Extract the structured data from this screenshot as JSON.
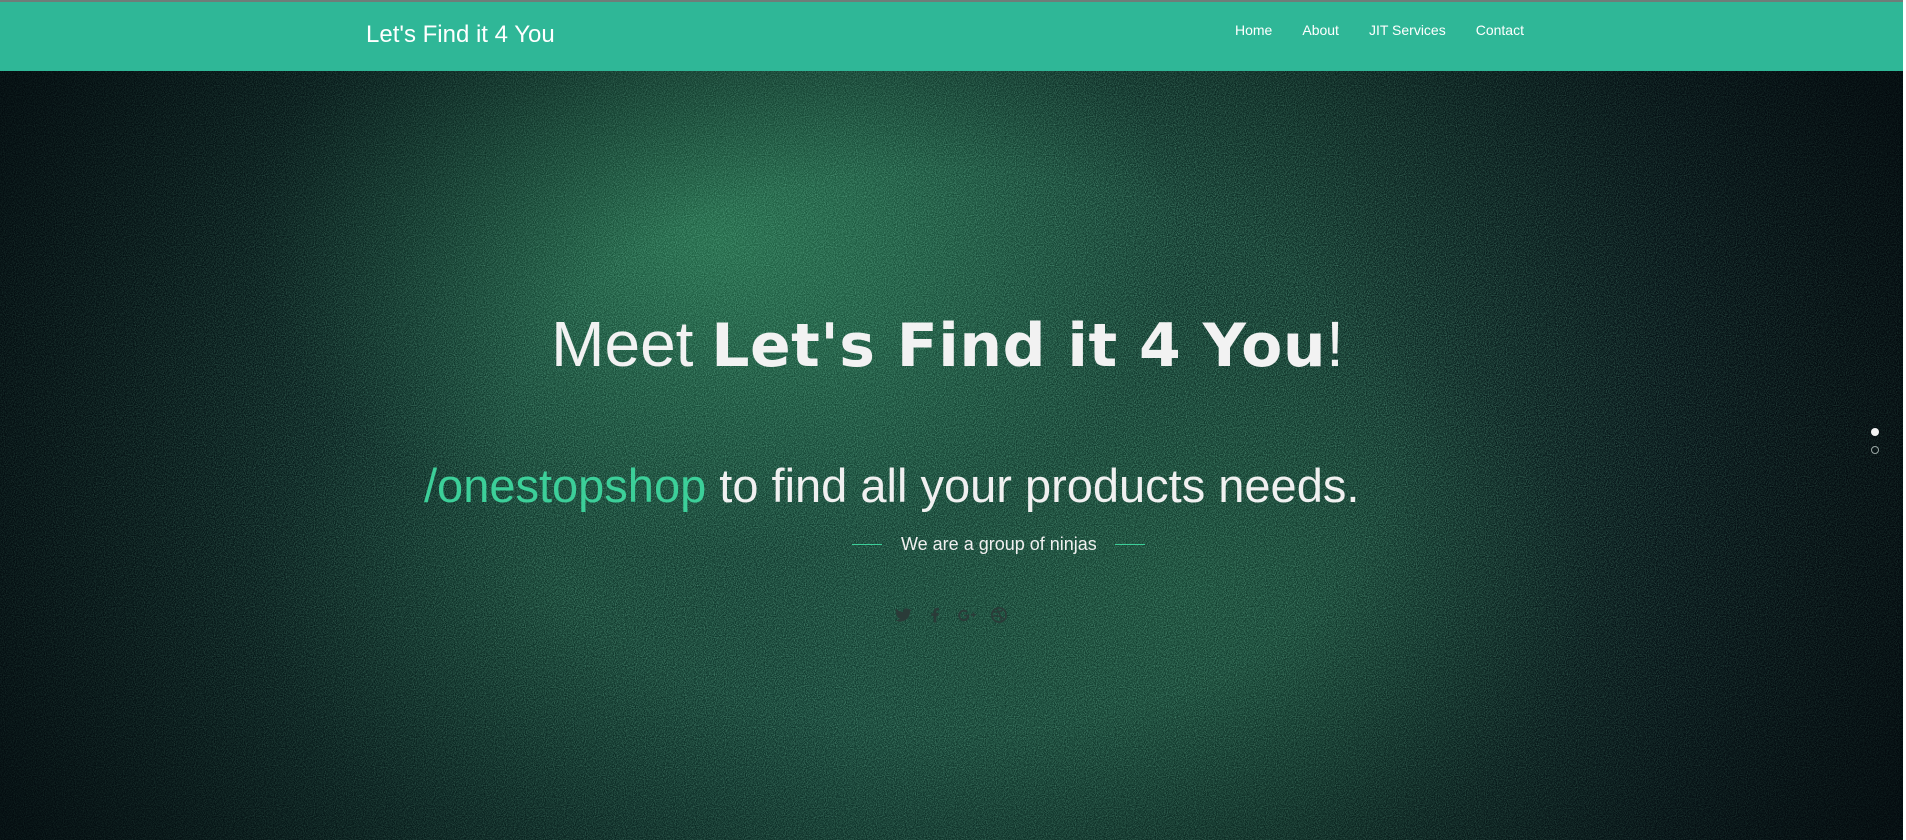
{
  "navbar": {
    "brand": "Let's Find it 4 You",
    "links": [
      {
        "label": "Home"
      },
      {
        "label": "About"
      },
      {
        "label": "JIT Services"
      },
      {
        "label": "Contact"
      }
    ],
    "background_color": "#2fb797"
  },
  "hero": {
    "title_prefix": "Meet ",
    "title_bold": "Let's Find it 4 You",
    "title_suffix": "!",
    "tagline_accent": "/onestopshop",
    "tagline_rest": " to find all your products needs.",
    "subline": "We are a group of ninjas",
    "accent_color": "#3ccf99",
    "social_icons": [
      "twitter-icon",
      "facebook-icon",
      "google-plus-icon",
      "dribbble-icon"
    ],
    "slides": {
      "total": 2,
      "active": 1
    }
  }
}
